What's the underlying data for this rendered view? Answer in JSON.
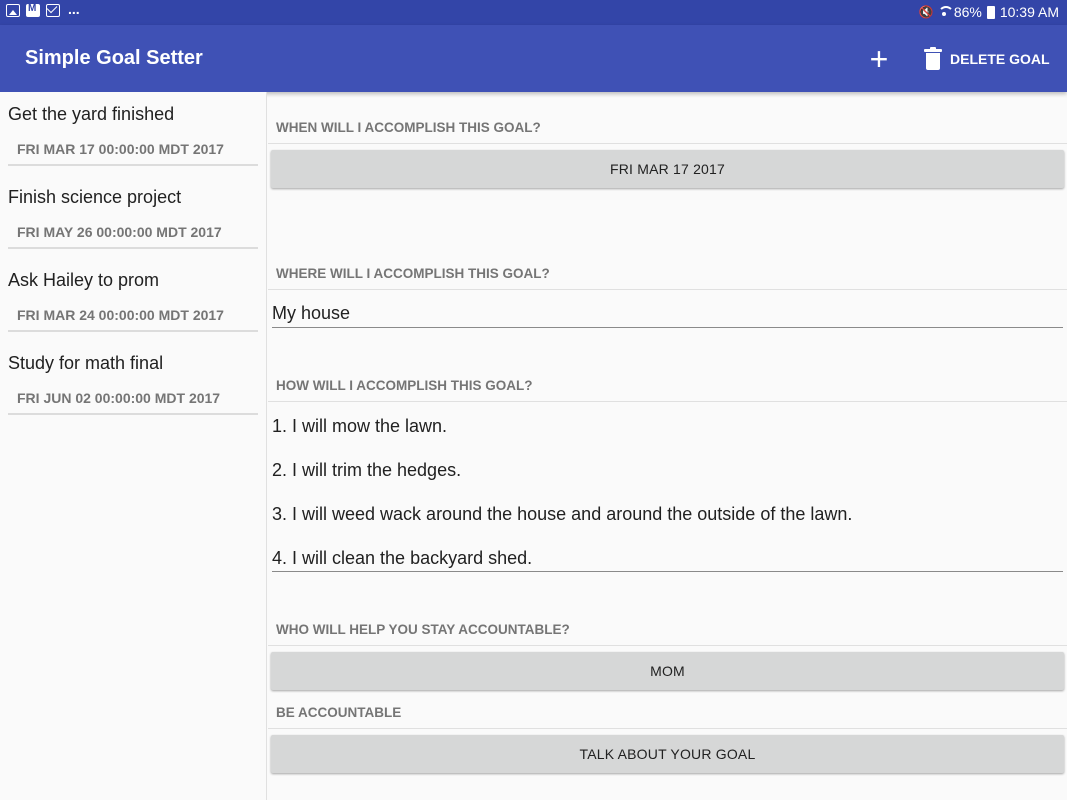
{
  "status_bar": {
    "more": "...",
    "battery": "86%",
    "time": "10:39 AM"
  },
  "app_bar": {
    "title": "Simple Goal Setter",
    "add_icon": "plus-icon",
    "delete_label": "DELETE GOAL",
    "delete_icon": "trash-icon"
  },
  "goals": [
    {
      "title": "Get the yard finished",
      "date": "FRI MAR 17 00:00:00 MDT 2017"
    },
    {
      "title": "Finish science project",
      "date": "FRI MAY 26 00:00:00 MDT 2017"
    },
    {
      "title": "Ask Hailey to prom",
      "date": "FRI MAR 24 00:00:00 MDT 2017"
    },
    {
      "title": "Study for math final",
      "date": "FRI JUN 02 00:00:00 MDT 2017"
    }
  ],
  "detail": {
    "when": {
      "header": "WHEN WILL I ACCOMPLISH THIS GOAL?",
      "button": "FRI MAR 17 2017"
    },
    "where": {
      "header": "WHERE WILL I ACCOMPLISH THIS GOAL?",
      "value": "My house"
    },
    "how": {
      "header": "HOW WILL I ACCOMPLISH THIS GOAL?",
      "lines": [
        "1. I will mow the lawn.",
        "2. I will trim the hedges.",
        "3. I will weed wack around the house and around the outside of the lawn.",
        "4. I will clean the backyard shed."
      ]
    },
    "who": {
      "header": "WHO WILL HELP YOU STAY ACCOUNTABLE?",
      "button": "MOM"
    },
    "accountable": {
      "header": "BE ACCOUNTABLE",
      "button": "TALK ABOUT YOUR GOAL"
    }
  },
  "colors": {
    "status_bar": "#3345a8",
    "app_bar": "#3f51b5",
    "button_bg": "#d6d7d7",
    "muted_text": "#757575"
  }
}
